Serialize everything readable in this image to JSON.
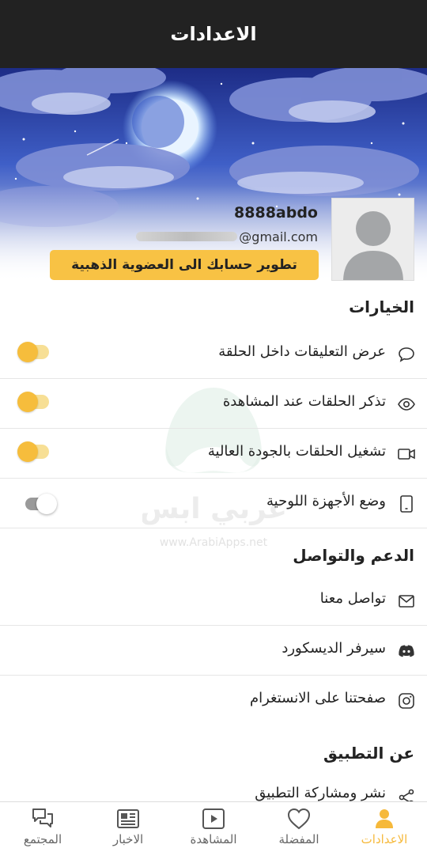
{
  "header": {
    "title": "الاعدادات"
  },
  "profile": {
    "username": "8888abdo",
    "email_suffix": "@gmail.com",
    "upgrade_button": "تطوير حسابك الى العضوية الذهبية"
  },
  "options": {
    "title": "الخيارات",
    "items": [
      {
        "label": "عرض التعليقات داخل الحلقة",
        "icon": "comment-icon",
        "toggle": "on"
      },
      {
        "label": "تذكر الحلقات عند المشاهدة",
        "icon": "eye-icon",
        "toggle": "on"
      },
      {
        "label": "تشغيل الحلقات بالجودة العالية",
        "icon": "video-camera-icon",
        "toggle": "on"
      },
      {
        "label": "وضع الأجهزة اللوحية",
        "icon": "tablet-icon",
        "toggle": "off"
      }
    ]
  },
  "support": {
    "title": "الدعم والتواصل",
    "items": [
      {
        "label": "تواصل معنا",
        "icon": "mail-icon"
      },
      {
        "label": "سيرفر الديسكورد",
        "icon": "discord-icon"
      },
      {
        "label": "صفحتنا على الانستغرام",
        "icon": "instagram-icon"
      }
    ]
  },
  "about": {
    "title": "عن التطبيق",
    "items": [
      {
        "label": "نشر ومشاركة التطبيق",
        "icon": "share-icon"
      }
    ]
  },
  "watermark": {
    "text": "عربي ابس",
    "url": "www.ArabiApps.net"
  },
  "bottom_nav": {
    "items": [
      {
        "label": "الاعدادات",
        "icon": "person-icon",
        "active": true
      },
      {
        "label": "المفضلة",
        "icon": "heart-icon",
        "active": false
      },
      {
        "label": "المشاهدة",
        "icon": "play-icon",
        "active": false
      },
      {
        "label": "الاخبار",
        "icon": "newspaper-icon",
        "active": false
      },
      {
        "label": "المجتمع",
        "icon": "chat-bubbles-icon",
        "active": false
      }
    ]
  },
  "colors": {
    "accent": "#f6b93b",
    "topbar": "#222222",
    "gold_button": "#f8c244"
  }
}
